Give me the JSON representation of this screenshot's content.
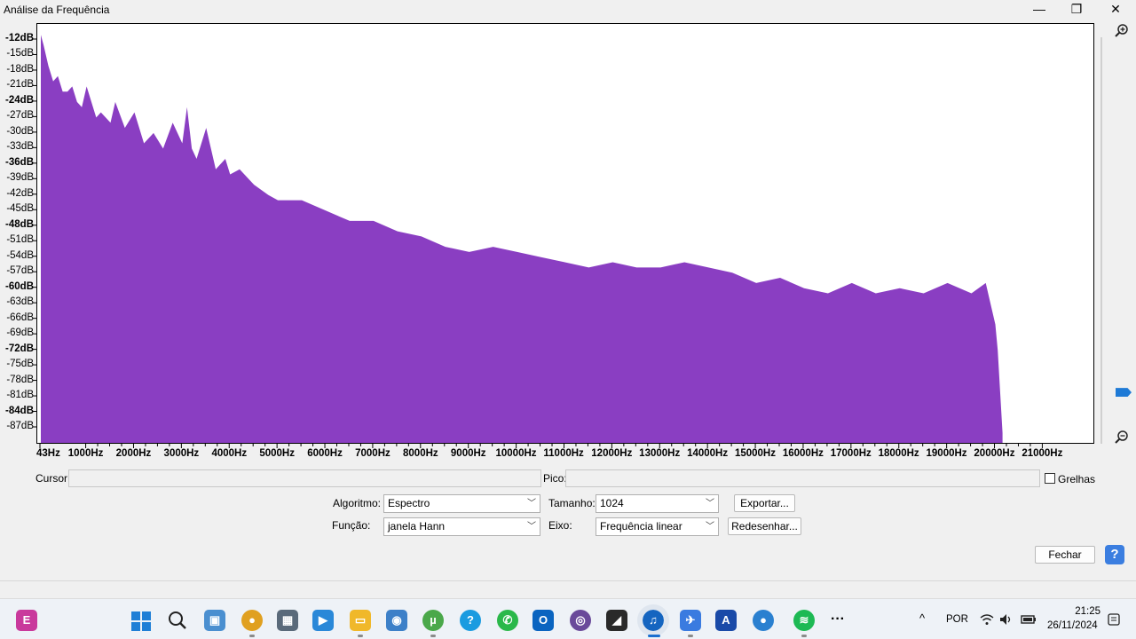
{
  "window": {
    "title": "Análise da Frequência",
    "minimize_glyph": "—",
    "restore_glyph": "❐",
    "close_glyph": "✕"
  },
  "chart_data": {
    "type": "area",
    "title": "",
    "xlabel": "",
    "ylabel": "",
    "xlim": [
      43,
      22050
    ],
    "ylim": [
      -90,
      -10
    ],
    "grid": false,
    "fill_color": "#8a3ec2",
    "y_tick_labels": [
      "-12dB",
      "-15dB",
      "-18dB",
      "-21dB",
      "-24dB",
      "-27dB",
      "-30dB",
      "-33dB",
      "-36dB",
      "-39dB",
      "-42dB",
      "-45dB",
      "-48dB",
      "-51dB",
      "-54dB",
      "-57dB",
      "-60dB",
      "-63dB",
      "-66dB",
      "-69dB",
      "-72dB",
      "-75dB",
      "-78dB",
      "-81dB",
      "-84dB",
      "-87dB"
    ],
    "y_tick_values": [
      -12,
      -15,
      -18,
      -21,
      -24,
      -27,
      -30,
      -33,
      -36,
      -39,
      -42,
      -45,
      -48,
      -51,
      -54,
      -57,
      -60,
      -63,
      -66,
      -69,
      -72,
      -75,
      -78,
      -81,
      -84,
      -87
    ],
    "x_tick_labels": [
      "43Hz",
      "1000Hz",
      "2000Hz",
      "3000Hz",
      "4000Hz",
      "5000Hz",
      "6000Hz",
      "7000Hz",
      "8000Hz",
      "9000Hz",
      "10000Hz",
      "11000Hz",
      "12000Hz",
      "13000Hz",
      "14000Hz",
      "15000Hz",
      "16000Hz",
      "17000Hz",
      "18000Hz",
      "19000Hz",
      "20000Hz",
      "21000Hz"
    ],
    "x_tick_values": [
      43,
      1000,
      2000,
      3000,
      4000,
      5000,
      6000,
      7000,
      8000,
      9000,
      10000,
      11000,
      12000,
      13000,
      14000,
      15000,
      16000,
      17000,
      18000,
      19000,
      20000,
      21000
    ],
    "x": [
      43,
      100,
      200,
      300,
      400,
      500,
      600,
      700,
      800,
      900,
      1000,
      1200,
      1300,
      1500,
      1600,
      1800,
      2000,
      2200,
      2400,
      2600,
      2800,
      3000,
      3100,
      3200,
      3300,
      3500,
      3700,
      3900,
      4000,
      4200,
      4500,
      4800,
      5000,
      5500,
      6000,
      6500,
      7000,
      7500,
      8000,
      8500,
      9000,
      9500,
      10000,
      10500,
      11000,
      11500,
      12000,
      12500,
      13000,
      13500,
      14000,
      14500,
      15000,
      15500,
      16000,
      16500,
      17000,
      17500,
      18000,
      18500,
      19000,
      19500,
      19800,
      19900,
      20000,
      20050,
      20100,
      20150
    ],
    "y": [
      -11,
      -13,
      -17,
      -20,
      -19,
      -22,
      -22,
      -21,
      -24,
      -25,
      -21,
      -27,
      -26,
      -28,
      -24,
      -29,
      -26,
      -32,
      -30,
      -33,
      -28,
      -32,
      -25,
      -33,
      -35,
      -29,
      -37,
      -35,
      -38,
      -37,
      -40,
      -42,
      -43,
      -43,
      -45,
      -47,
      -47,
      -49,
      -50,
      -52,
      -53,
      -52,
      -53,
      -54,
      -55,
      -56,
      -55,
      -56,
      -56,
      -55,
      -56,
      -57,
      -59,
      -58,
      -60,
      -61,
      -59,
      -61,
      -60,
      -61,
      -59,
      -61,
      -59,
      -63,
      -67,
      -72,
      -80,
      -88
    ]
  },
  "controls": {
    "cursor_label": "Cursor:",
    "cursor_value": "",
    "peak_label": "Pico:",
    "peak_value": "",
    "grid_label": "Grelhas",
    "algorithm_label": "Algoritmo:",
    "algorithm_value": "Espectro",
    "size_label": "Tamanho:",
    "size_value": "1024",
    "export_button": "Exportar...",
    "function_label": "Função:",
    "function_value": "janela Hann",
    "axis_label": "Eixo:",
    "axis_value": "Frequência linear",
    "redraw_button": "Redesenhar...",
    "close_button": "Fechar",
    "help_glyph": "?"
  },
  "zoom": {
    "zoom_in_icon": "zoom-in-icon",
    "zoom_out_icon": "zoom-out-icon",
    "slider_level": 0.08
  },
  "taskbar": {
    "language": "POR",
    "time": "21:25",
    "date": "26/11/2024",
    "more_glyph": "···",
    "chevron_glyph": "^"
  }
}
